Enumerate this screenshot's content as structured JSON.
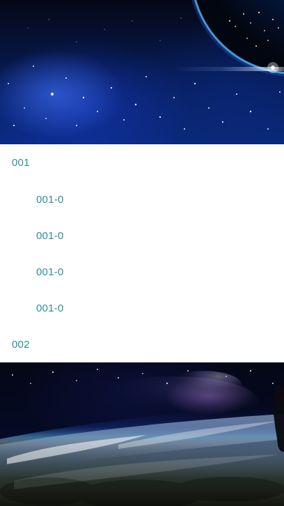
{
  "menu": {
    "items": [
      {
        "label": "001",
        "level": 1
      },
      {
        "label": "001-0",
        "level": 2
      },
      {
        "label": "001-0",
        "level": 2
      },
      {
        "label": "001-0",
        "level": 2
      },
      {
        "label": "001-0",
        "level": 2
      },
      {
        "label": "002",
        "level": 1
      }
    ]
  },
  "theme": {
    "menu_text_color": "#2b8f98",
    "background": "#ffffff"
  }
}
